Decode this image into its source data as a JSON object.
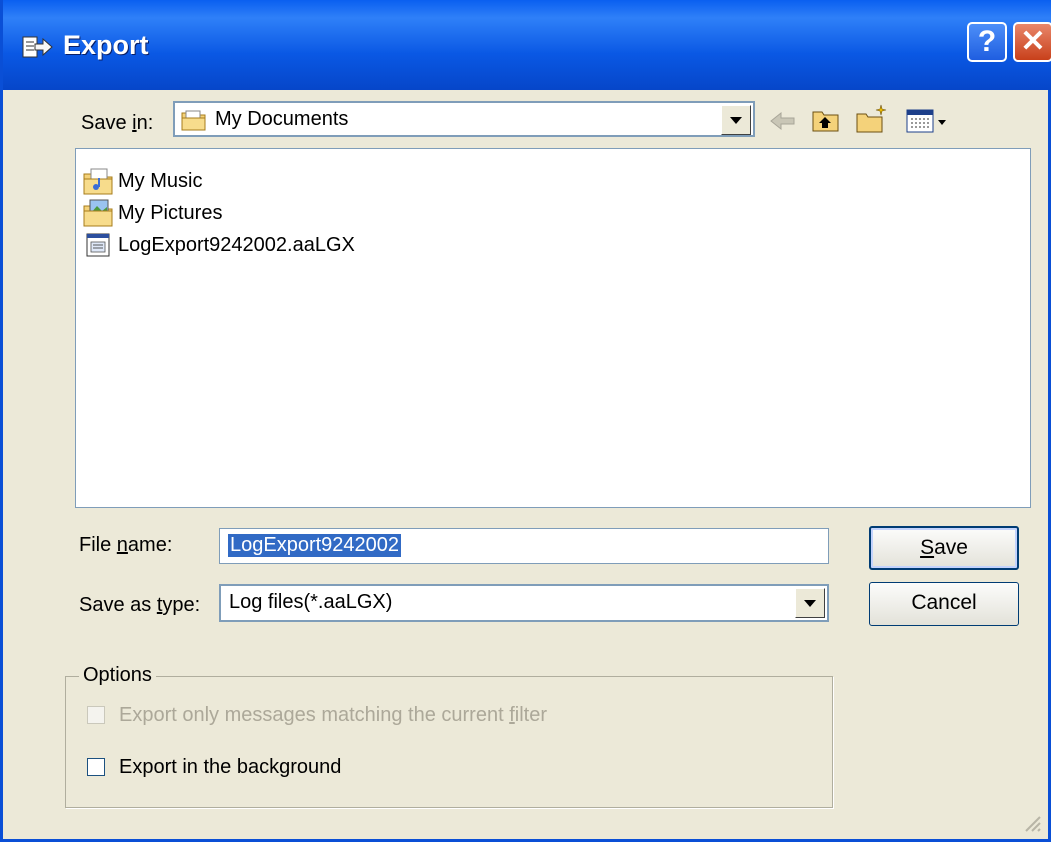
{
  "window": {
    "title": "Export"
  },
  "titlebar": {
    "help_glyph": "?",
    "close_glyph": "✕"
  },
  "save_in": {
    "label_pre": "Save ",
    "label_mnemonic": "i",
    "label_post": "n:",
    "value": "My Documents"
  },
  "toolbar": {
    "icons": [
      "back-arrow-icon",
      "up-folder-icon",
      "new-folder-icon",
      "view-menu-icon"
    ]
  },
  "files": [
    {
      "name": "My Music",
      "icon": "music-folder-icon"
    },
    {
      "name": "My Pictures",
      "icon": "pictures-folder-icon"
    },
    {
      "name": "LogExport9242002.aaLGX",
      "icon": "log-file-icon"
    }
  ],
  "file_name": {
    "label_pre": "File ",
    "label_mnemonic": "n",
    "label_post": "ame:",
    "value": "LogExport9242002"
  },
  "save_as_type": {
    "label_pre": "Save as ",
    "label_mnemonic": "t",
    "label_post": "ype:",
    "value": "Log files(*.aaLGX)"
  },
  "buttons": {
    "save_mnemonic": "S",
    "save_rest": "ave",
    "cancel": "Cancel"
  },
  "options": {
    "title": "Options",
    "filter_pre": "Export only messages matching the current ",
    "filter_mnemonic": "f",
    "filter_post": "ilter",
    "filter_checked": false,
    "filter_enabled": false,
    "background": "Export in the background",
    "background_checked": false
  },
  "colors": {
    "title_blue": "#0a58e4",
    "dialog_bg": "#ece9d8",
    "selection": "#316ac5",
    "close_red": "#c8401b"
  }
}
